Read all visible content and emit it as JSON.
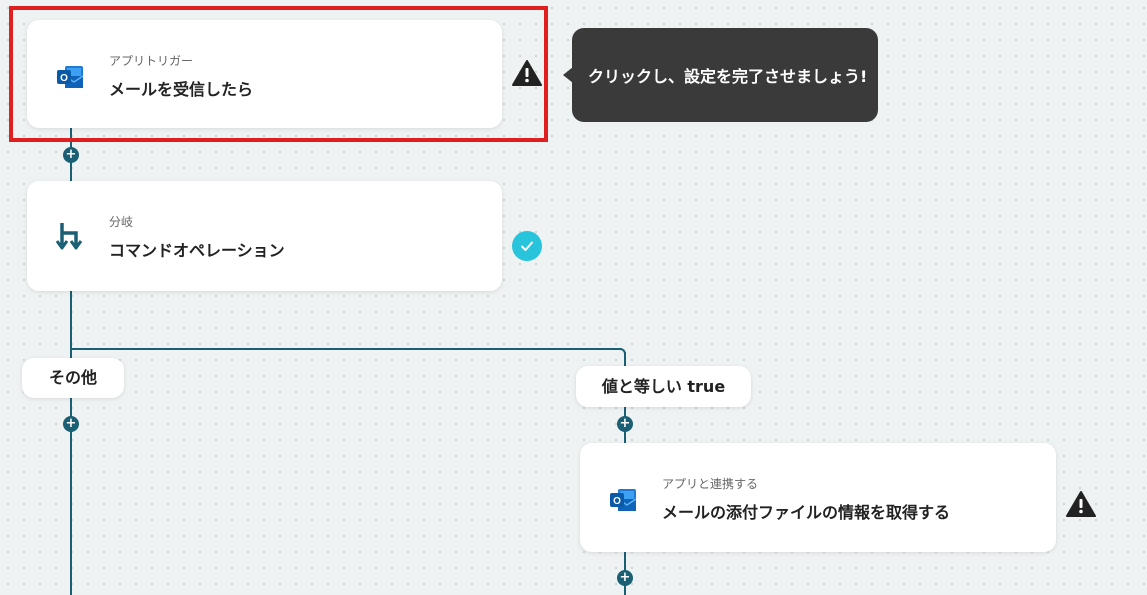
{
  "steps": [
    {
      "kind": "アプリトリガー",
      "title": "メールを受信したら",
      "icon": "outlook-icon",
      "status": "warning"
    },
    {
      "kind": "分岐",
      "title": "コマンドオペレーション",
      "icon": "branch-icon",
      "status": "complete"
    },
    {
      "kind": "アプリと連携する",
      "title": "メールの添付ファイルの情報を取得する",
      "icon": "outlook-icon",
      "status": "warning"
    }
  ],
  "branches": {
    "other_label": "その他",
    "true_label": "値と等しい true"
  },
  "tooltip": {
    "text": "クリックし、設定を完了させましょう!"
  },
  "colors": {
    "connector": "#1b5f74",
    "warning": "#222222",
    "complete": "#27c4dc",
    "highlight": "#e02020",
    "tooltip_bg": "#3a3a3a"
  }
}
